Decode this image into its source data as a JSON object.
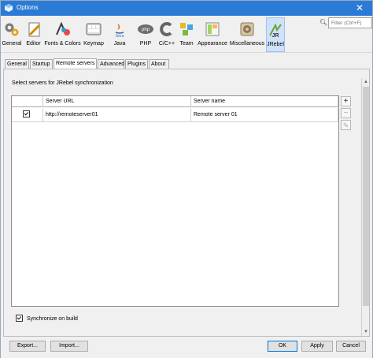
{
  "window": {
    "title": "Options"
  },
  "toolbar": {
    "items": [
      {
        "label": "General",
        "icon": "general-gears-icon"
      },
      {
        "label": "Editor",
        "icon": "editor-icon"
      },
      {
        "label": "Fonts & Colors",
        "icon": "fonts-colors-icon"
      },
      {
        "label": "Keymap",
        "icon": "keymap-icon"
      },
      {
        "label": "Java",
        "icon": "java-icon"
      },
      {
        "label": "PHP",
        "icon": "php-icon"
      },
      {
        "label": "C/C++",
        "icon": "cpp-icon"
      },
      {
        "label": "Team",
        "icon": "team-icon"
      },
      {
        "label": "Appearance",
        "icon": "appearance-icon"
      },
      {
        "label": "Miscellaneous",
        "icon": "miscellaneous-icon"
      },
      {
        "label": "JRebel",
        "icon": "jrebel-icon",
        "selected": true
      }
    ]
  },
  "filter": {
    "placeholder": "Filter (Ctrl+F)"
  },
  "tabs": [
    {
      "label": "General"
    },
    {
      "label": "Startup"
    },
    {
      "label": "Remote servers",
      "active": true
    },
    {
      "label": "Advanced"
    },
    {
      "label": "Plugins"
    },
    {
      "label": "About"
    }
  ],
  "main": {
    "caption": "Select servers for JRebel synchronization",
    "table": {
      "columns": [
        "",
        "Server URL",
        "Server name"
      ],
      "rows": [
        {
          "checked": true,
          "url": "http://remoteserver01",
          "name": "Remote server 01"
        }
      ]
    },
    "sync_checkbox_label": "Synchronize on build",
    "sync_checked": true
  },
  "buttons": {
    "export": "Export...",
    "import": "Import...",
    "ok": "OK",
    "apply": "Apply",
    "cancel": "Cancel"
  },
  "colors": {
    "titlebar": "#2b7bd6",
    "selected_tool": "#cfe2fb",
    "primary_border": "#0078d7"
  }
}
